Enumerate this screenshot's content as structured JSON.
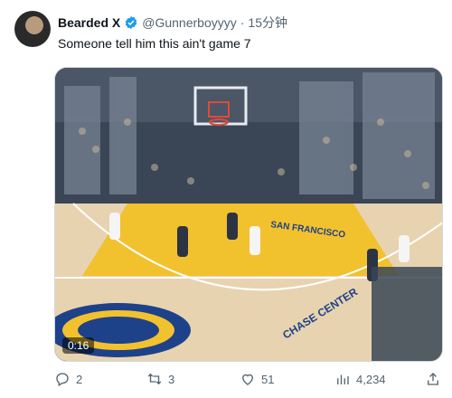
{
  "tweet": {
    "display_name": "Bearded X",
    "handle": "@Gunnerboyyyy",
    "separator": "·",
    "time": "15分钟",
    "text": "Someone tell him this ain't game 7",
    "verified_icon": "verified-badge-icon",
    "colors": {
      "verified": "#1d9bf0",
      "muted": "#536471",
      "text": "#0f1419"
    }
  },
  "media": {
    "type": "video",
    "timestamp": "0:16",
    "court_text": "SAN FRANCISCO",
    "baseline_text": "CHASE CENTER",
    "colors": {
      "court": "#e8d3b0",
      "paint": "#f2c12e",
      "logo": "#1d428a"
    }
  },
  "actions": {
    "replies": "2",
    "reposts": "3",
    "likes": "51",
    "views": "4,234"
  }
}
